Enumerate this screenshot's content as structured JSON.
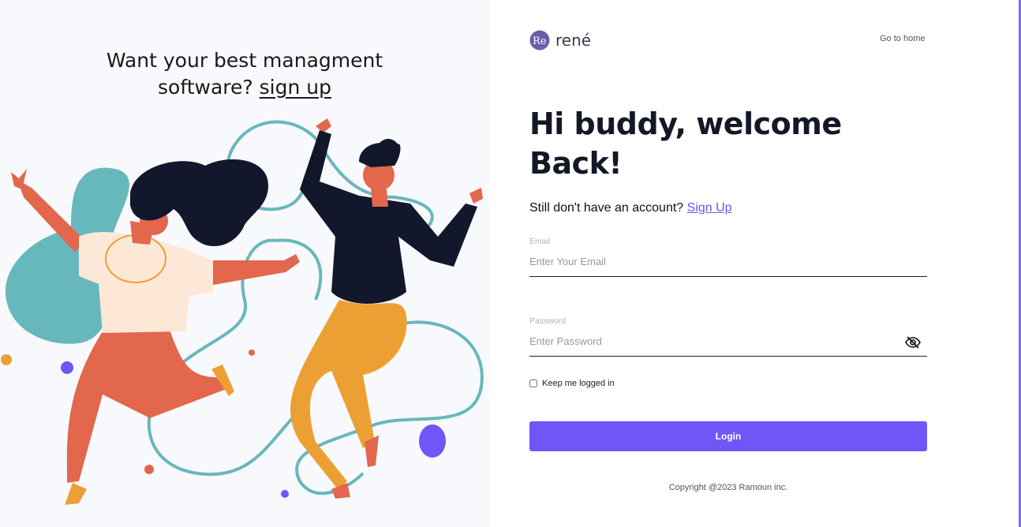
{
  "promo": {
    "line1": "Want your best managment",
    "line2_prefix": "software?",
    "signup_link": "sign up"
  },
  "brand": {
    "logo_text": "Re",
    "name": "rené"
  },
  "nav": {
    "go_home": "Go to home"
  },
  "welcome": {
    "line1": "Hi buddy, welcome",
    "line2": "Back!"
  },
  "signup_prompt": {
    "text": "Still don't have an account?",
    "link": "Sign Up"
  },
  "form": {
    "email": {
      "label": "Email",
      "placeholder": "Enter Your Email",
      "value": ""
    },
    "password": {
      "label": "Password",
      "placeholder": "Enter Password",
      "value": "",
      "toggle_icon": "eye-off-icon"
    },
    "remember": {
      "label": "Keep me logged in",
      "checked": false
    },
    "submit_label": "Login"
  },
  "footer": {
    "copyright": "Copyright @2023 Ramoun inc."
  },
  "colors": {
    "accent": "#7056f9",
    "link": "#6c55f0",
    "left_panel_bg": "#f8f9fc",
    "teal": "#67b8bc",
    "navy": "#13172b",
    "coral": "#e2674d",
    "mustard": "#eca034"
  }
}
